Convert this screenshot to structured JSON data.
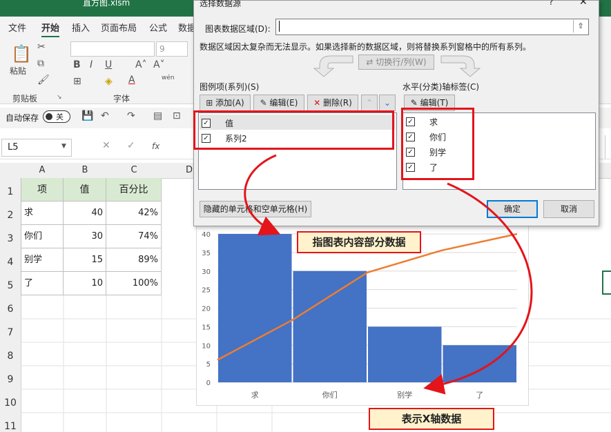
{
  "window": {
    "filename": "直方图.xlsm"
  },
  "ribbon": {
    "tabs": [
      "文件",
      "开始",
      "插入",
      "页面布局",
      "公式",
      "数据"
    ],
    "font_size": "9",
    "groups": {
      "clipboard": "剪贴板",
      "font": "字体"
    },
    "paste_label": "粘贴",
    "wen_label": "wén"
  },
  "qat": {
    "autosave_label": "自动保存",
    "toggle_label": "关"
  },
  "formula_bar": {
    "name_box": "L5",
    "fx_label": "fx"
  },
  "sheet": {
    "columns": [
      "A",
      "B",
      "C",
      "D"
    ],
    "rows": [
      "1",
      "2",
      "3",
      "4",
      "5",
      "6",
      "7",
      "8",
      "9",
      "10",
      "11"
    ],
    "header": [
      "项",
      "值",
      "百分比"
    ],
    "data": [
      [
        "求",
        "40",
        "42%"
      ],
      [
        "你们",
        "30",
        "74%"
      ],
      [
        "别学",
        "15",
        "89%"
      ],
      [
        "了",
        "10",
        "100%"
      ]
    ]
  },
  "dialog": {
    "title": "选择数据源",
    "help": "?",
    "range_label": "图表数据区域(D):",
    "range_value": "",
    "message": "数据区域因太复杂而无法显示。如果选择新的数据区域，则将替换系列窗格中的所有系列。",
    "switch_label": "切换行/列(W)",
    "legend_label": "图例项(系列)(S)",
    "add_label": "添加(A)",
    "edit_label": "编辑(E)",
    "delete_label": "删除(R)",
    "series": [
      "值",
      "系列2"
    ],
    "axis_label": "水平(分类)轴标签(C)",
    "axis_edit_label": "编辑(T)",
    "categories": [
      "求",
      "你们",
      "别学",
      "了"
    ],
    "hidden_cells_label": "隐藏的单元格和空单元格(H)",
    "ok_label": "确定",
    "cancel_label": "取消"
  },
  "chart_data": {
    "type": "bar",
    "categories": [
      "求",
      "你们",
      "别学",
      "了"
    ],
    "series": [
      {
        "name": "值",
        "type": "bar",
        "values": [
          40,
          30,
          15,
          10
        ],
        "color": "#4472c4"
      },
      {
        "name": "系列2",
        "type": "line",
        "values": [
          0.42,
          0.74,
          0.89,
          1.0
        ],
        "color": "#ed7d31"
      }
    ],
    "y_ticks": [
      "0",
      "5",
      "10",
      "15",
      "20",
      "25",
      "30",
      "35",
      "40"
    ],
    "ylim": [
      0,
      40
    ],
    "grid": true
  },
  "annotations": {
    "callout1": "指图表内容部分数据",
    "callout2": "表示X轴数据",
    "color": "#e3141a"
  }
}
